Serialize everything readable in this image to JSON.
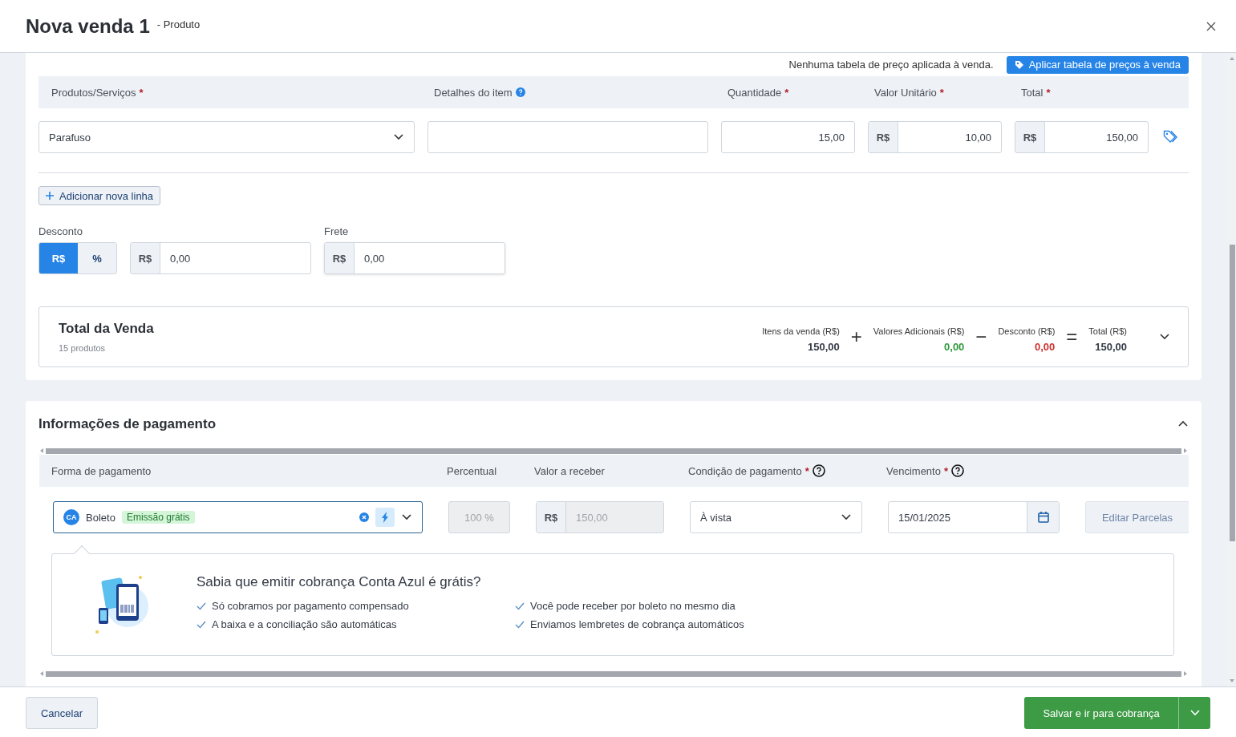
{
  "header": {
    "title": "Nova venda 1",
    "subtitle": "- Produto"
  },
  "price_table": {
    "message": "Nenhuma tabela de preço aplicada à venda.",
    "button": "Aplicar tabela de preços à venda"
  },
  "items_table": {
    "columns": [
      {
        "label": "Produtos/Serviços",
        "mark": "*",
        "help": false
      },
      {
        "label": "Detalhes do item",
        "help": true
      },
      {
        "label": "Quantidade",
        "mark": "*",
        "help": false
      },
      {
        "label": "Valor Unitário",
        "mark": "*",
        "help": false
      },
      {
        "label": "Total",
        "mark": "*",
        "help": false
      }
    ],
    "rows": [
      {
        "product": "Parafuso",
        "quantity": "15,00",
        "unit_currency": "R$",
        "unit_value": "10,00",
        "total_currency": "R$",
        "total": "150,00"
      }
    ]
  },
  "add_line": "Adicionar nova linha",
  "discount": {
    "label": "Desconto",
    "modes": [
      {
        "label": "R$",
        "selected": true
      },
      {
        "label": "%",
        "selected": false
      }
    ],
    "currency": "R$",
    "value": "0,00"
  },
  "freight": {
    "label": "Frete",
    "currency": "R$",
    "value": "0,00"
  },
  "sale_total": {
    "title": "Total da Venda",
    "subtitle": "15 produtos",
    "expanded": false,
    "parts": [
      {
        "kind": "amount",
        "label": "Itens da venda (R$)",
        "value": "150,00",
        "color": "#333a45"
      },
      {
        "kind": "operator",
        "symbol": "+"
      },
      {
        "kind": "amount",
        "label": "Valores Adicionais (R$)",
        "value": "0,00",
        "color": "#2e9a3c"
      },
      {
        "kind": "operator",
        "symbol": "−"
      },
      {
        "kind": "amount",
        "label": "Desconto (R$)",
        "value": "0,00",
        "color": "#d0312d"
      },
      {
        "kind": "operator",
        "symbol": "="
      },
      {
        "kind": "amount",
        "label": "Total (R$)",
        "value": "150,00",
        "color": "#333a45"
      }
    ]
  },
  "payment": {
    "title": "Informações de pagamento",
    "expanded": true,
    "columns": [
      {
        "label": "Forma de pagamento",
        "help": false
      },
      {
        "label": "Percentual",
        "help": false
      },
      {
        "label": "Valor a receber",
        "help": false
      },
      {
        "label": "Condição de pagamento",
        "mark": "*",
        "help": true
      },
      {
        "label": "Vencimento",
        "mark": "*",
        "help": true
      }
    ],
    "row": {
      "method_badge": "CA",
      "method": "Boleto",
      "tag": "Emissão grátis",
      "percent": "100 %",
      "percent_disabled": true,
      "currency": "R$",
      "amount": "150,00",
      "amount_disabled": true,
      "condition": "À vista",
      "due_date": "15/01/2025",
      "edit_button": "Editar Parcelas"
    },
    "promo": {
      "title": "Sabia que emitir cobrança Conta Azul é grátis?",
      "benefits": [
        "Só cobramos por pagamento compensado",
        "Você pode receber por boleto no mesmo dia",
        "A baixa e a conciliação são automáticas",
        "Enviamos lembretes de cobrança automáticos"
      ]
    }
  },
  "footer": {
    "cancel": "Cancelar",
    "primary": "Salvar e ir para cobrança"
  }
}
